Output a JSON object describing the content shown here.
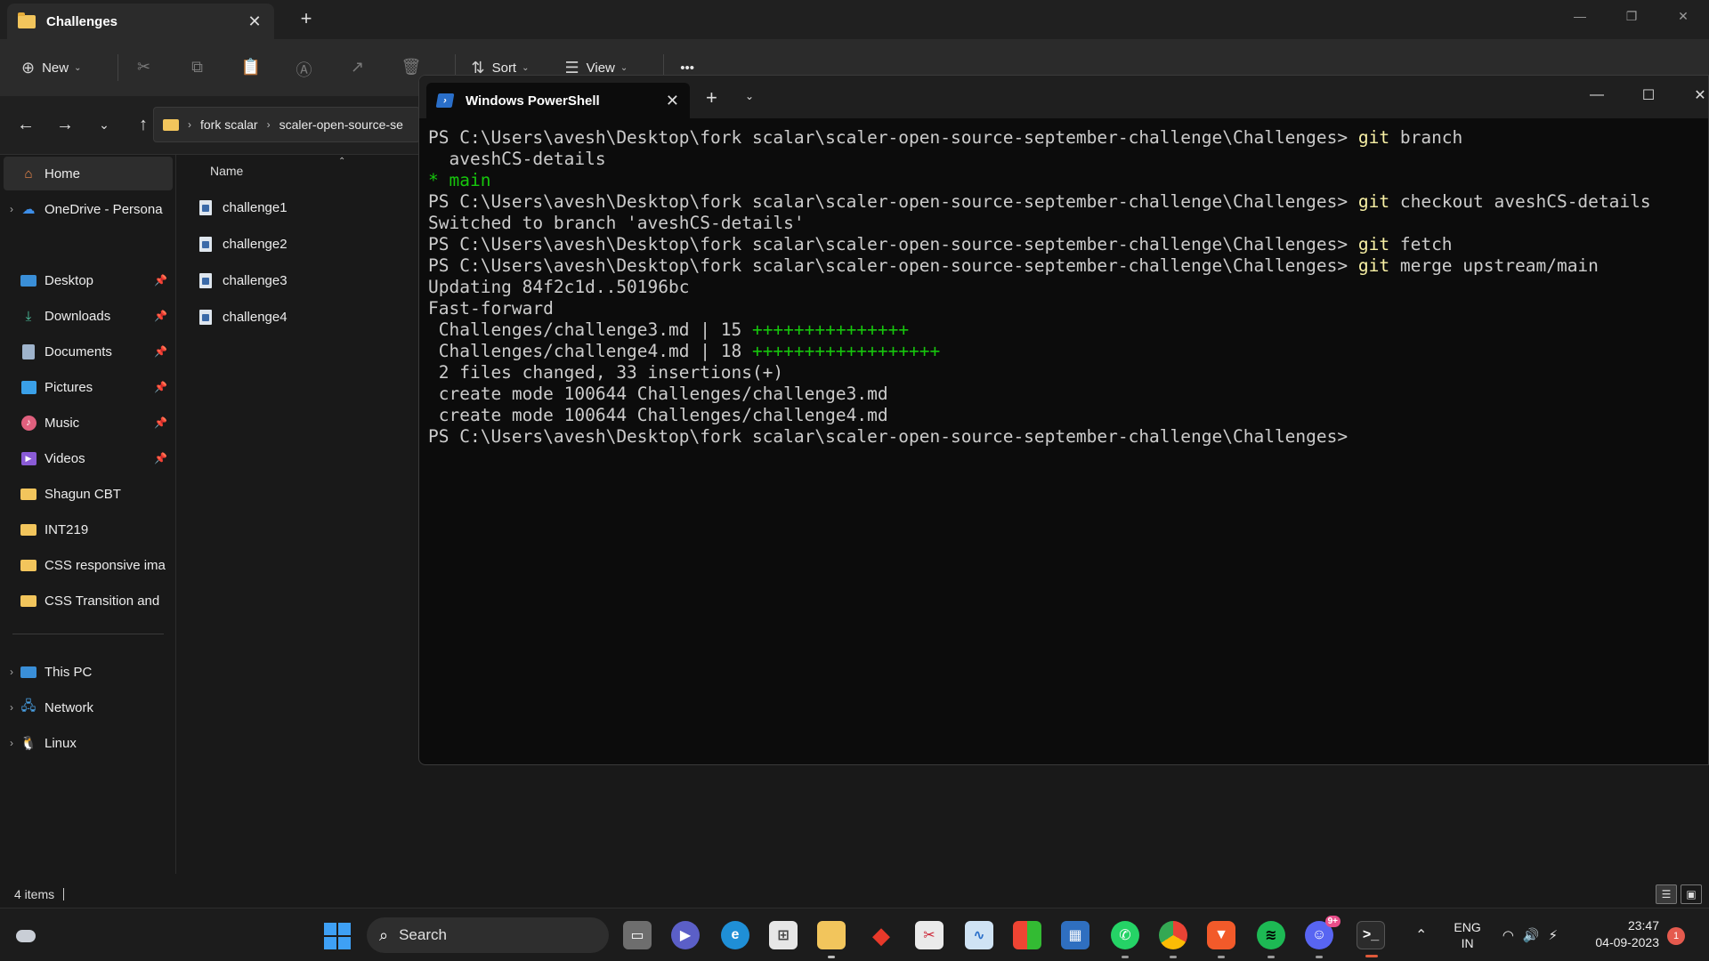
{
  "explorer": {
    "tab_title": "Challenges",
    "toolbar": {
      "new_label": "New",
      "sort_label": "Sort",
      "view_label": "View"
    },
    "address": {
      "crumbs": [
        "fork scalar",
        "scaler-open-source-se"
      ]
    },
    "sidebar": {
      "home": "Home",
      "onedrive": "OneDrive - Persona",
      "desktop": "Desktop",
      "downloads": "Downloads",
      "documents": "Documents",
      "pictures": "Pictures",
      "music": "Music",
      "videos": "Videos",
      "f1": "Shagun CBT",
      "f2": "INT219",
      "f3": "CSS responsive ima",
      "f4": "CSS Transition and",
      "this_pc": "This PC",
      "network": "Network",
      "linux": "Linux"
    },
    "filelist": {
      "column_name": "Name",
      "files": [
        "challenge1",
        "challenge2",
        "challenge3",
        "challenge4"
      ]
    },
    "status": "4 items"
  },
  "terminal": {
    "tab_title": "Windows PowerShell",
    "prompt": "PS C:\\Users\\avesh\\Desktop\\fork scalar\\scaler-open-source-september-challenge\\Challenges>",
    "lines": {
      "l1_cmd": "git",
      "l1_args": " branch",
      "l2": "  aveshCS-details",
      "l3": "* main",
      "l4_cmd": "git",
      "l4_args": " checkout aveshCS-details",
      "l5": "Switched to branch 'aveshCS-details'",
      "l6_cmd": "git",
      "l6_args": " fetch",
      "l7_cmd": "git",
      "l7_args": " merge upstream/main",
      "l8": "Updating 84f2c1d..50196bc",
      "l9": "Fast-forward",
      "l10": " Challenges/challenge3.md | 15 ",
      "l10_plus": "+++++++++++++++",
      "l11": " Challenges/challenge4.md | 18 ",
      "l11_plus": "++++++++++++++++++",
      "l12": " 2 files changed, 33 insertions(+)",
      "l13": " create mode 100644 Challenges/challenge3.md",
      "l14": " create mode 100644 Challenges/challenge4.md"
    }
  },
  "taskbar": {
    "search_label": "Search",
    "discord_badge": "9+",
    "lang_top": "ENG",
    "lang_bottom": "IN",
    "time": "23:47",
    "date": "04-09-2023",
    "notification_count": "1"
  },
  "colors": {
    "git_command": "#f9f1a5",
    "git_green": "#16c60c",
    "accent_blue": "#3ea0f5"
  }
}
